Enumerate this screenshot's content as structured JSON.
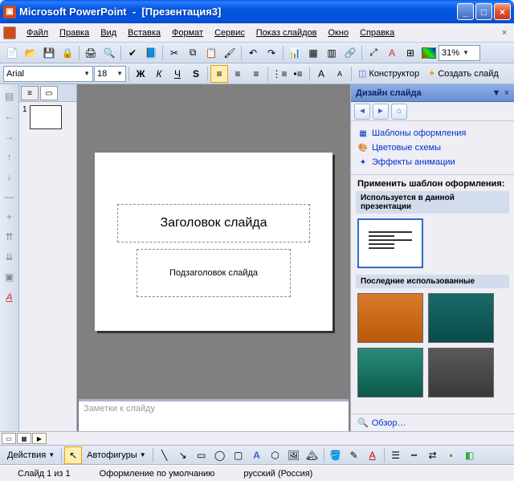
{
  "titlebar": {
    "app": "Microsoft PowerPoint",
    "doc": "[Презентация3]"
  },
  "menu": {
    "file": "Файл",
    "edit": "Правка",
    "view": "Вид",
    "insert": "Вставка",
    "format": "Формат",
    "tools": "Сервис",
    "slideshow": "Показ слайдов",
    "window": "Окно",
    "help": "Справка"
  },
  "toolbar1": {
    "zoom": "31%"
  },
  "toolbar2": {
    "font": "Arial",
    "size": "18",
    "designer": "Конструктор",
    "newslide": "Создать слайд"
  },
  "outline": {
    "slide_num": "1"
  },
  "slide": {
    "title": "Заголовок слайда",
    "subtitle": "Подзаголовок слайда"
  },
  "notes": {
    "placeholder": "Заметки к слайду"
  },
  "taskpane": {
    "title": "Дизайн слайда",
    "link_templates": "Шаблоны оформления",
    "link_colors": "Цветовые схемы",
    "link_anim": "Эффекты анимации",
    "apply_label": "Применить шаблон оформления:",
    "group_current": "Используется в данной презентации",
    "group_recent": "Последние использованные",
    "browse": "Обзор…"
  },
  "drawbar": {
    "actions": "Действия",
    "autoshapes": "Автофигуры"
  },
  "status": {
    "slide": "Слайд 1 из 1",
    "design": "Оформление по умолчанию",
    "lang": "русский (Россия)"
  }
}
